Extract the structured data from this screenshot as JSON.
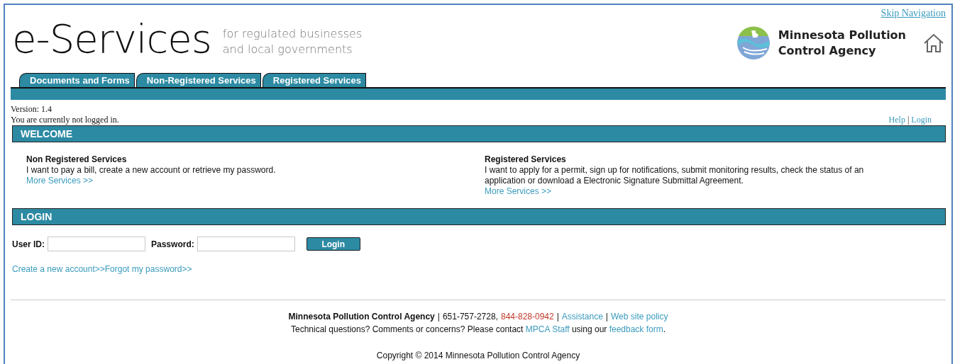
{
  "header": {
    "skip_link": "Skip Navigation",
    "logo_text": "e-Services",
    "tagline": [
      "for regulated businesses",
      "and local governments"
    ],
    "agency_name": [
      "Minnesota Pollution",
      "Control Agency"
    ]
  },
  "tabs": [
    {
      "label": "Documents and Forms",
      "selected": false
    },
    {
      "label": "Non-Registered Services",
      "selected": false
    },
    {
      "label": "Registered Services",
      "selected": false
    }
  ],
  "status": {
    "version": "Version: 1.4",
    "login_state": "You are currently not logged in.",
    "links": [
      "Help",
      "Login"
    ],
    "separator": "|"
  },
  "welcome": {
    "title": "WELCOME",
    "sections": [
      {
        "heading": "Non Registered Services",
        "text": "I want to pay a bill, create a new account or retrieve my password.",
        "link": "More Services >>"
      },
      {
        "heading": "Registered Services",
        "text": "I want to apply for a permit, sign up for notifications, submit monitoring results, check the status of an application or download a Electronic Signature Submittal Agreement.",
        "link": "More Services >>"
      }
    ]
  },
  "login": {
    "title": "LOGIN",
    "user_label": "User ID:",
    "password_label": "Password:",
    "button": "Login",
    "links": [
      "Create a new account>>",
      "Forgot my password>>"
    ]
  },
  "footer": {
    "agency": "Minnesota Pollution Control Agency",
    "phone": "651-757-2728,",
    "hotline": "844-828-0942",
    "links": [
      "Assistance",
      "Web site policy"
    ],
    "separators": [
      "|",
      "|",
      "|"
    ],
    "contact": {
      "before": "Technical questions? Comments or concerns? Please contact",
      "link1": "MPCA Staff",
      "middle": "using our",
      "link2": "feedback form",
      "after": "."
    },
    "copyright": "Copyright © 2014 Minnesota Pollution Control Agency"
  }
}
